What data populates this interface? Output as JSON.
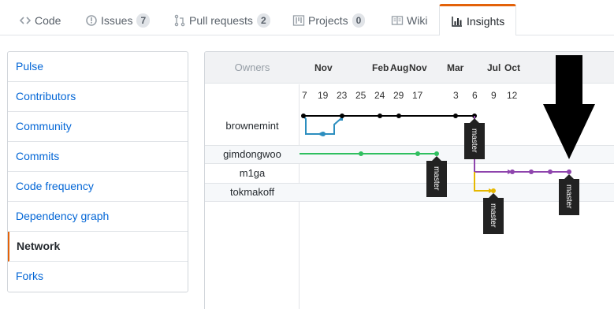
{
  "tabs": [
    {
      "label": "Code",
      "icon": "code-icon"
    },
    {
      "label": "Issues",
      "icon": "issue-icon",
      "count": "7"
    },
    {
      "label": "Pull requests",
      "icon": "pull-request-icon",
      "count": "2"
    },
    {
      "label": "Projects",
      "icon": "project-icon",
      "count": "0"
    },
    {
      "label": "Wiki",
      "icon": "book-icon"
    },
    {
      "label": "Insights",
      "icon": "graph-icon",
      "active": true
    }
  ],
  "sidebar": {
    "items": [
      {
        "label": "Pulse"
      },
      {
        "label": "Contributors"
      },
      {
        "label": "Community"
      },
      {
        "label": "Commits"
      },
      {
        "label": "Code frequency"
      },
      {
        "label": "Dependency graph"
      },
      {
        "label": "Network",
        "selected": true
      },
      {
        "label": "Forks"
      }
    ]
  },
  "network": {
    "owners_label": "Owners",
    "months": [
      "Nov",
      "Feb",
      "Aug",
      "Nov",
      "Mar",
      "Jul",
      "Oct"
    ],
    "days": [
      "7",
      "19",
      "23",
      "25",
      "24",
      "29",
      "17",
      "3",
      "6",
      "9",
      "12"
    ],
    "owners": [
      "brownemint",
      "gimdongwoo",
      "m1ga",
      "tokmakoff"
    ],
    "branch_label": "master",
    "colors": {
      "brownemint": "#000000",
      "brownemint_branch": "#2c8ebf",
      "gimdongwoo": "#2fbf5f",
      "m1ga": "#8e44ad",
      "tokmakoff": "#e6b800"
    }
  },
  "annotation": {
    "icon": "down-arrow-icon"
  }
}
